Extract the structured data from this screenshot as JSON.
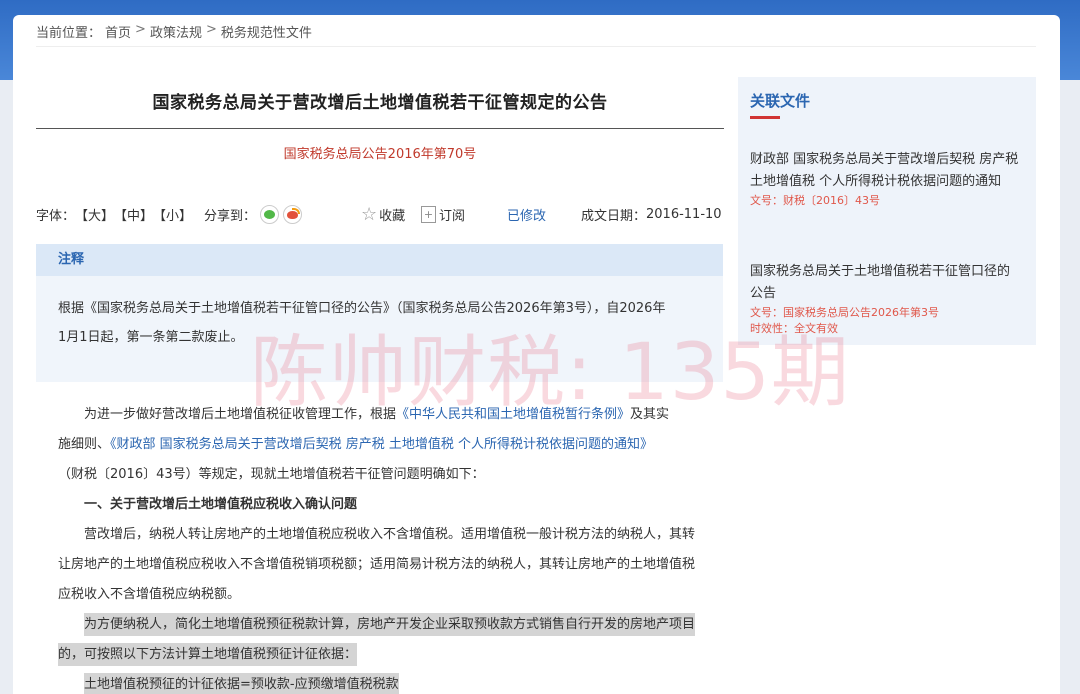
{
  "breadcrumb": {
    "prefix": "当前位置：",
    "items": [
      "首页",
      "政策法规",
      "税务规范性文件"
    ],
    "separator": ">"
  },
  "article": {
    "title": "国家税务总局关于营改增后土地增值税若干征管规定的公告",
    "doc_number": "国家税务总局公告2016年第70号"
  },
  "toolbar": {
    "font_label": "字体：",
    "size_large": "【大】",
    "size_medium": "【中】",
    "size_small": "【小】",
    "share_label": "分享到：",
    "share_icons": [
      "wechat-icon",
      "weibo-icon"
    ],
    "favorite": "收藏",
    "subscribe": "订阅",
    "modified": "已修改",
    "date_label": "成文日期：",
    "date_value": "2016-11-10"
  },
  "note": {
    "heading": "注释",
    "line1": "根据《国家税务总局关于土地增值税若干征管口径的公告》（国家税务总局公告2026年第3号），自2026年",
    "line2": "1月1日起，第一条第二款废止。"
  },
  "body": {
    "p1_a": "为进一步做好营改增后土地增值税征收管理工作，根据",
    "p1_link1": "《中华人民共和国土地增值税暂行条例》",
    "p1_b": "及其实",
    "p1_c": "施细则、",
    "p1_link2": "《财政部 国家税务总局关于营改增后契税 房产税 土地增值税 个人所得税计税依据问题的通知》",
    "p1_d": "（财税〔2016〕43号）等规定，现就土地增值税若干征管问题明确如下：",
    "heading1": "一、关于营改增后土地增值税应税收入确认问题",
    "p2": "营改增后，纳税人转让房地产的土地增值税应税收入不含增值税。适用增值税一般计税方法的纳税人，其转让房地产的土地增值税应税收入不含增值税销项税额；适用简易计税方法的纳税人，其转让房地产的土地增值税应税收入不含增值税应纳税额。",
    "p3": "为方便纳税人，简化土地增值税预征税款计算，房地产开发企业采取预收款方式销售自行开发的房地产项目的，可按照以下方法计算土地增值税预征计征依据：",
    "p4": "土地增值税预征的计征依据=预收款-应预缴增值税税款"
  },
  "related": {
    "title": "关联文件",
    "items": [
      {
        "title": "财政部 国家税务总局关于营改增后契税 房产税 土地增值税 个人所得税计税依据问题的通知",
        "doc_no": "文号：财税〔2016〕43号"
      },
      {
        "title": "国家税务总局关于土地增值税若干征管口径的公告",
        "doc_no": "文号：国家税务总局公告2026年第3号",
        "validity": "时效性：全文有效"
      }
    ]
  },
  "watermark": "陈帅财税: 135期",
  "colors": {
    "accent_blue": "#2b66b1",
    "doc_red": "#c0392b",
    "header_blue": "#2f6cc4"
  }
}
